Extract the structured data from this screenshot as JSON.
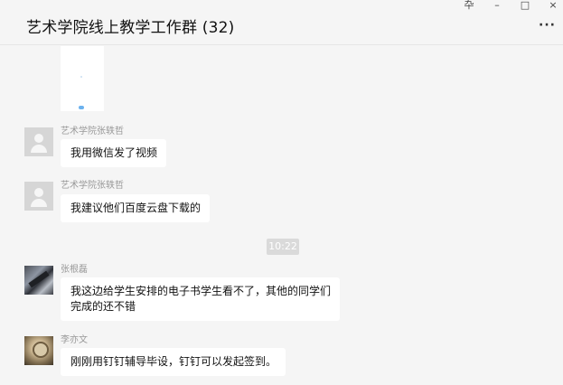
{
  "window": {
    "title": "艺术学院线上教学工作群 (32)",
    "controls": {
      "pin": "卆",
      "minimize": "–",
      "maximize": "□",
      "close": "×"
    },
    "more_label": "···"
  },
  "messages": [
    {
      "sender": "艺术学院张轶哲",
      "text": "我用微信发了视频"
    },
    {
      "sender": "艺术学院张轶哲",
      "text": "我建议他们百度云盘下载的"
    },
    {
      "sender": "张根磊",
      "text_line1": "我这边给学生安排的电子书学生看不了，其他的同学们",
      "text_line2": "完成的还不错"
    },
    {
      "sender": "李亦文",
      "text": "刚刚用钉钉辅导毕设，钉钉可以发起签到。"
    }
  ],
  "timestamp": "10:22",
  "icons": {
    "pin": "pin-icon",
    "minimize": "minimize-icon",
    "maximize": "maximize-icon",
    "close": "close-icon",
    "more": "more-icon",
    "default_avatar": "default-avatar-icon"
  }
}
